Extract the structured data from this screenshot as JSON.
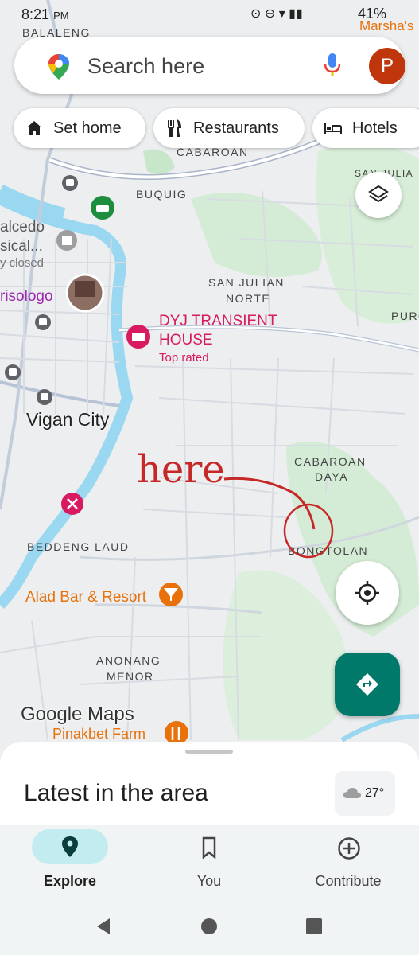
{
  "status_bar": {
    "time": "8:21",
    "ampm": "PM",
    "battery": "41%"
  },
  "search": {
    "placeholder": "Search here",
    "avatar_initial": "P"
  },
  "chips": [
    {
      "label": "Set home",
      "icon": "home-icon"
    },
    {
      "label": "Restaurants",
      "icon": "restaurant-icon"
    },
    {
      "label": "Hotels",
      "icon": "hotel-icon"
    }
  ],
  "map_labels": {
    "balaleng": "BALALENG",
    "marshas": "Marsha's",
    "cabaroan_top": "CABAROAN",
    "san_julia": "SAN JULIA",
    "buquig": "BUQUIG",
    "alcedo": "alcedo",
    "sical": "sical...",
    "closed": "y closed",
    "risologo": "risologo",
    "san_julian_norte_1": "SAN JULIAN",
    "san_julian_norte_2": "NORTE",
    "puro": "PURO",
    "dyj_1": "DYJ TRANSIENT",
    "dyj_2": "HOUSE",
    "dyj_rating": "Top rated",
    "vigan": "Vigan City",
    "cabaroan_daya_1": "CABAROAN",
    "cabaroan_daya_2": "DAYA",
    "bongtolan": "BONGTOLAN",
    "beddeng": "BEDDENG LAUD",
    "alad": "Alad Bar & Resort",
    "anonang_1": "ANONANG",
    "anonang_2": "MENOR",
    "pinakbet": "Pinakbet Farm",
    "annotation": "here"
  },
  "watermark": "Google Maps",
  "bottom_sheet": {
    "title": "Latest in the area",
    "temperature": "27°"
  },
  "bottom_nav": [
    {
      "label": "Explore",
      "active": true
    },
    {
      "label": "You",
      "active": false
    },
    {
      "label": "Contribute",
      "active": false
    }
  ],
  "colors": {
    "accent_teal": "#00796b",
    "annotation_red": "#c62828",
    "poi_pink": "#d81b60",
    "poi_orange": "#e8710a",
    "water": "#9ad7f0",
    "park": "#c8e6c9"
  }
}
